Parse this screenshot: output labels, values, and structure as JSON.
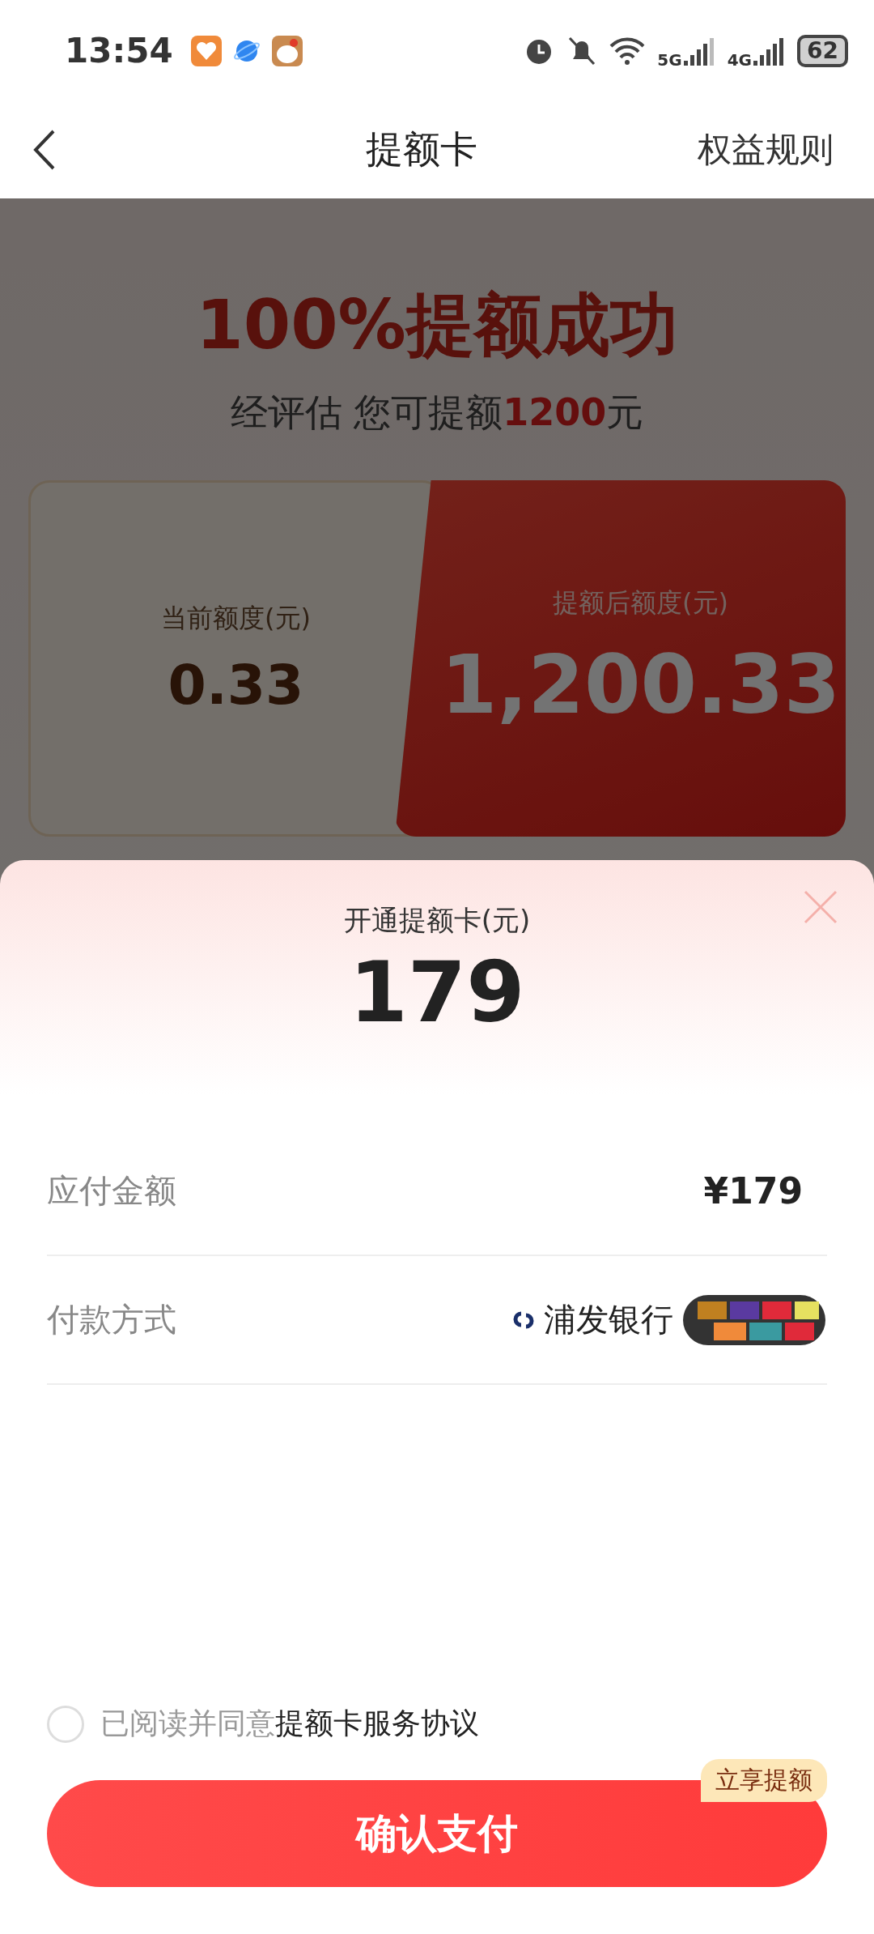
{
  "status_bar": {
    "time": "13:54",
    "network_labels": [
      "5G",
      "4G"
    ],
    "battery": "62"
  },
  "nav": {
    "title": "提额卡",
    "action": "权益规则"
  },
  "promo": {
    "headline": "100%提额成功",
    "subtitle": "经评估 您可提额**1200**元",
    "current": {
      "label": "当前额度(元)",
      "value": "0.33"
    },
    "after": {
      "label": "提额后额度(元)",
      "value": "1,200.33"
    }
  },
  "sheet": {
    "title": "开通提额卡(元)",
    "amount": "179",
    "rows": [
      {
        "kind": "text",
        "label": "应付金额",
        "value": "¥179"
      },
      {
        "kind": "bank",
        "label": "付款方式",
        "value": "浦发银行"
      }
    ],
    "agreement": {
      "checked": false,
      "prefix": "已阅读并同意",
      "link": "提额卡服务协议"
    },
    "button": "确认支付",
    "badge": "立享提额"
  }
}
